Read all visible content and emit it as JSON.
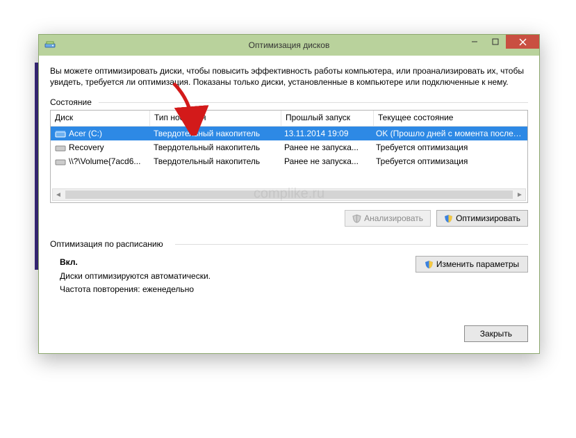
{
  "window": {
    "title": "Оптимизация дисков"
  },
  "intro": "Вы можете оптимизировать диски, чтобы повысить эффективность работы компьютера, или проанализировать их, чтобы увидеть, требуется ли оптимизация. Показаны только диски, установленные в компьютере или подключенные к нему.",
  "status_label": "Состояние",
  "columns": {
    "disk": "Диск",
    "type": "Тип носителя",
    "last": "Прошлый запуск",
    "state": "Текущее состояние"
  },
  "rows": [
    {
      "disk": "Acer (C:)",
      "type": "Твердотельный накопитель",
      "last": "13.11.2014 19:09",
      "state": "OK (Прошло дней с момента последне..."
    },
    {
      "disk": "Recovery",
      "type": "Твердотельный накопитель",
      "last": "Ранее не запуска...",
      "state": "Требуется оптимизация"
    },
    {
      "disk": "\\\\?\\Volume{7acd6...",
      "type": "Твердотельный накопитель",
      "last": "Ранее не запуска...",
      "state": "Требуется оптимизация"
    }
  ],
  "buttons": {
    "analyze": "Анализировать",
    "optimize": "Оптимизировать",
    "change_settings": "Изменить параметры",
    "close": "Закрыть"
  },
  "schedule": {
    "label": "Оптимизация по расписанию",
    "enabled": "Вкл.",
    "line1": "Диски оптимизируются автоматически.",
    "line2": "Частота повторения: еженедельно"
  },
  "watermark": "complike.ru"
}
